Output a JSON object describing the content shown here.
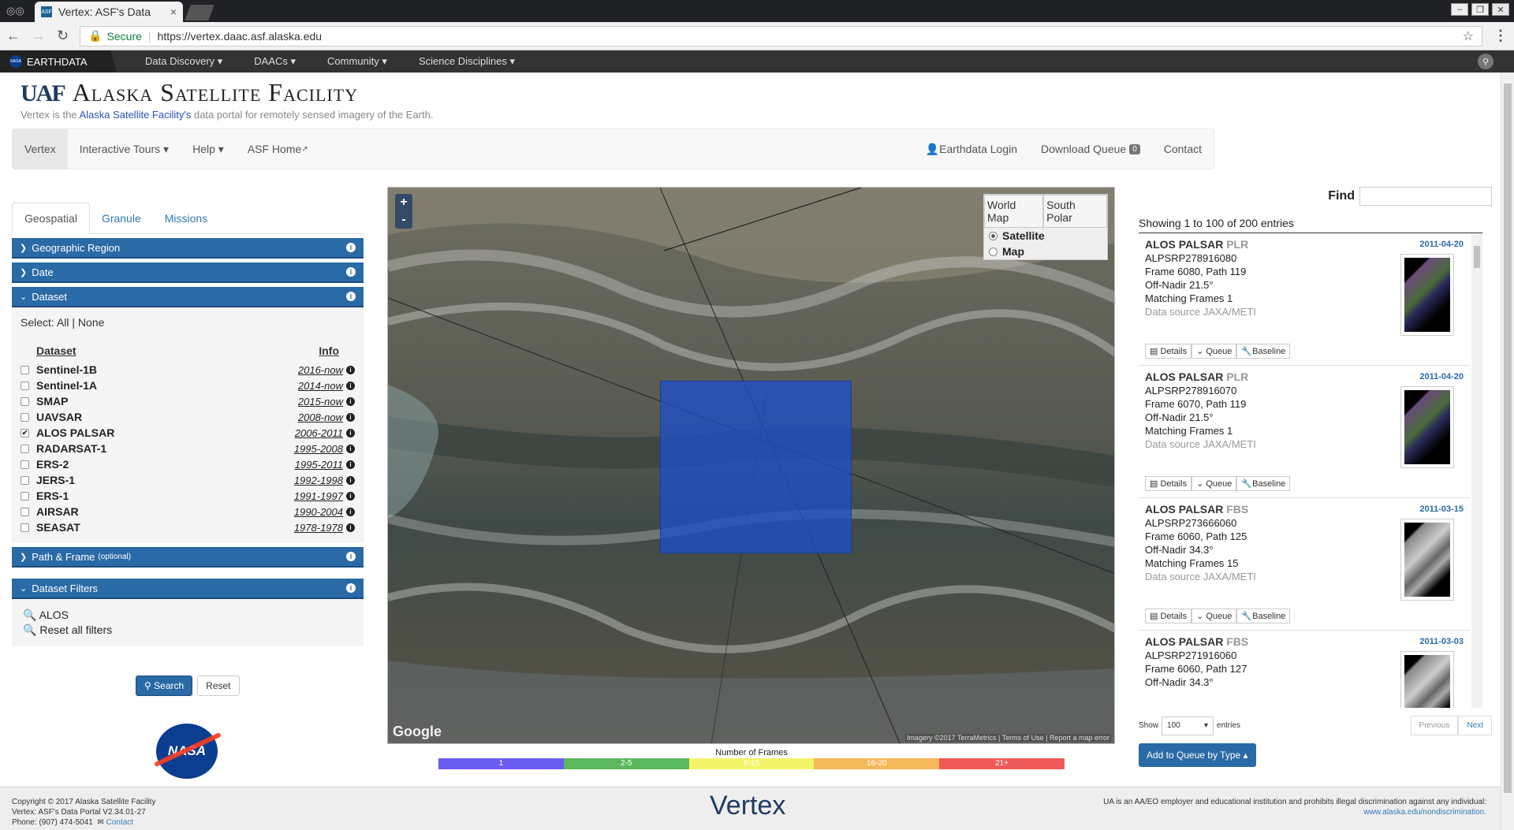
{
  "browser": {
    "tab_title": "Vertex: ASF's Data",
    "tab_close": "×",
    "secure_label": "Secure",
    "url": "https://vertex.daac.asf.alaska.edu"
  },
  "earthdata": {
    "brand": "EARTHDATA",
    "menu": [
      "Data Discovery",
      "DAACs",
      "Community",
      "Science Disciplines"
    ]
  },
  "header": {
    "uaf": "UAF",
    "title": "Alaska Satellite Facility",
    "tagline_pre": "Vertex is the ",
    "tagline_link": "Alaska Satellite Facility's",
    "tagline_post": " data portal for remotely sensed imagery of the Earth."
  },
  "navbar": {
    "left": [
      "Vertex",
      "Interactive Tours",
      "Help",
      "ASF Home"
    ],
    "login": "Earthdata Login",
    "queue": "Download Queue",
    "queue_count": "0",
    "contact": "Contact"
  },
  "left": {
    "tabs": [
      "Geospatial",
      "Granule",
      "Missions"
    ],
    "sections": {
      "geo": "Geographic Region",
      "date": "Date",
      "dataset": "Dataset",
      "path": "Path & Frame",
      "path_note": "(optional)",
      "filters": "Dataset Filters"
    },
    "select_label": "Select:",
    "select_all": "All",
    "select_none": "None",
    "col_dataset": "Dataset",
    "col_info": "Info",
    "datasets": [
      {
        "name": "Sentinel-1B",
        "years": "2016-now",
        "checked": false
      },
      {
        "name": "Sentinel-1A",
        "years": "2014-now",
        "checked": false
      },
      {
        "name": "SMAP",
        "years": "2015-now",
        "checked": false
      },
      {
        "name": "UAVSAR",
        "years": "2008-now",
        "checked": false
      },
      {
        "name": "ALOS PALSAR",
        "years": "2006-2011",
        "checked": true
      },
      {
        "name": "RADARSAT-1",
        "years": "1995-2008",
        "checked": false
      },
      {
        "name": "ERS-2",
        "years": "1995-2011",
        "checked": false
      },
      {
        "name": "JERS-1",
        "years": "1992-1998",
        "checked": false
      },
      {
        "name": "ERS-1",
        "years": "1991-1997",
        "checked": false
      },
      {
        "name": "AIRSAR",
        "years": "1990-2004",
        "checked": false
      },
      {
        "name": "SEASAT",
        "years": "1978-1978",
        "checked": false
      }
    ],
    "filter_items": [
      "ALOS",
      "Reset all filters"
    ],
    "search_btn": "Search",
    "reset_btn": "Reset",
    "nasa": "NASA"
  },
  "map": {
    "zoom_in": "+",
    "zoom_out": "-",
    "tab_world": "World Map",
    "tab_south": "South Polar",
    "opt_satellite": "Satellite",
    "opt_map": "Map",
    "google": "Google",
    "attribution": "Imagery ©2017 TerraMetrics | Terms of Use | Report a map error"
  },
  "legend": {
    "title": "Number of Frames",
    "bins": [
      {
        "label": "1",
        "color": "#6a5cf0"
      },
      {
        "label": "2-5",
        "color": "#5cb85c"
      },
      {
        "label": "6-15",
        "color": "#f4f46a"
      },
      {
        "label": "16-20",
        "color": "#f5b85a"
      },
      {
        "label": "21+",
        "color": "#f0595a"
      }
    ]
  },
  "results": {
    "find_label": "Find",
    "showing": "Showing 1 to 100 of 200 entries",
    "items": [
      {
        "platform": "ALOS PALSAR",
        "mode": "PLR",
        "date": "2011-04-20",
        "granule": "ALPSRP278916080",
        "frame": "Frame 6080, Path 119",
        "offnadir": "Off-Nadir 21.5°",
        "matching": "Matching Frames 1",
        "source": "Data source JAXA/METI"
      },
      {
        "platform": "ALOS PALSAR",
        "mode": "PLR",
        "date": "2011-04-20",
        "granule": "ALPSRP278916070",
        "frame": "Frame 6070, Path 119",
        "offnadir": "Off-Nadir 21.5°",
        "matching": "Matching Frames 1",
        "source": "Data source JAXA/METI"
      },
      {
        "platform": "ALOS PALSAR",
        "mode": "FBS",
        "date": "2011-03-15",
        "granule": "ALPSRP273666060",
        "frame": "Frame 6060, Path 125",
        "offnadir": "Off-Nadir 34.3°",
        "matching": "Matching Frames 15",
        "source": "Data source JAXA/METI"
      },
      {
        "platform": "ALOS PALSAR",
        "mode": "FBS",
        "date": "2011-03-03",
        "granule": "ALPSRP271916060",
        "frame": "Frame 6060, Path 127",
        "offnadir": "Off-Nadir 34.3°",
        "matching": "",
        "source": ""
      }
    ],
    "btn_details": "Details",
    "btn_queue": "Queue",
    "btn_baseline": "Baseline",
    "show_label": "Show",
    "show_value": "100",
    "entries_label": "entries",
    "prev": "Previous",
    "next": "Next",
    "add_queue": "Add to Queue by Type"
  },
  "footer": {
    "copyright": "Copyright © 2017 Alaska Satellite Facility",
    "version": "Vertex: ASF's Data Portal V2.34.01-27",
    "phone": "Phone: (907) 474-5041",
    "contact": "Contact",
    "center": "Vertex",
    "right1": "UA is an AA/EO employer and educational institution and prohibits illegal discrimination against any individual:",
    "right2": "www.alaska.edu/nondiscrimination."
  }
}
